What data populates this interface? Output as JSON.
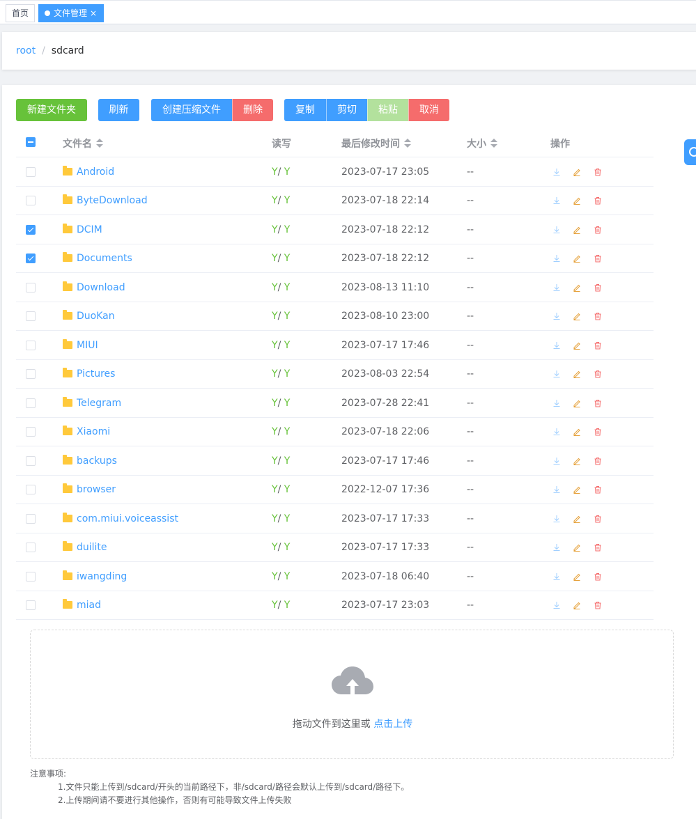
{
  "tabs": {
    "home": "首页",
    "active": "文件管理",
    "close": "×"
  },
  "breadcrumb": {
    "root": "root",
    "separator": "/",
    "current": "sdcard"
  },
  "toolbar": {
    "new_folder": "新建文件夹",
    "refresh": "刷新",
    "create_zip": "创建压缩文件",
    "delete": "删除",
    "copy": "复制",
    "cut": "剪切",
    "paste": "粘贴",
    "cancel": "取消"
  },
  "table": {
    "headers": {
      "name": "文件名",
      "rw": "读写",
      "modified": "最后修改时间",
      "size": "大小",
      "actions": "操作"
    },
    "rows": [
      {
        "name": "Android",
        "r": "Y",
        "w": "Y",
        "time": "2023-07-17 23:05",
        "size": "--",
        "checked": false
      },
      {
        "name": "ByteDownload",
        "r": "Y",
        "w": "Y",
        "time": "2023-07-18 22:14",
        "size": "--",
        "checked": false
      },
      {
        "name": "DCIM",
        "r": "Y",
        "w": "Y",
        "time": "2023-07-18 22:12",
        "size": "--",
        "checked": true
      },
      {
        "name": "Documents",
        "r": "Y",
        "w": "Y",
        "time": "2023-07-18 22:12",
        "size": "--",
        "checked": true
      },
      {
        "name": "Download",
        "r": "Y",
        "w": "Y",
        "time": "2023-08-13 11:10",
        "size": "--",
        "checked": false
      },
      {
        "name": "DuoKan",
        "r": "Y",
        "w": "Y",
        "time": "2023-08-10 23:00",
        "size": "--",
        "checked": false
      },
      {
        "name": "MIUI",
        "r": "Y",
        "w": "Y",
        "time": "2023-07-17 17:46",
        "size": "--",
        "checked": false
      },
      {
        "name": "Pictures",
        "r": "Y",
        "w": "Y",
        "time": "2023-08-03 22:54",
        "size": "--",
        "checked": false
      },
      {
        "name": "Telegram",
        "r": "Y",
        "w": "Y",
        "time": "2023-07-28 22:41",
        "size": "--",
        "checked": false
      },
      {
        "name": "Xiaomi",
        "r": "Y",
        "w": "Y",
        "time": "2023-07-18 22:06",
        "size": "--",
        "checked": false
      },
      {
        "name": "backups",
        "r": "Y",
        "w": "Y",
        "time": "2023-07-17 17:46",
        "size": "--",
        "checked": false
      },
      {
        "name": "browser",
        "r": "Y",
        "w": "Y",
        "time": "2022-12-07 17:36",
        "size": "--",
        "checked": false
      },
      {
        "name": "com.miui.voiceassist",
        "r": "Y",
        "w": "Y",
        "time": "2023-07-17 17:33",
        "size": "--",
        "checked": false
      },
      {
        "name": "duilite",
        "r": "Y",
        "w": "Y",
        "time": "2023-07-17 17:33",
        "size": "--",
        "checked": false
      },
      {
        "name": "iwangding",
        "r": "Y",
        "w": "Y",
        "time": "2023-07-18 06:40",
        "size": "--",
        "checked": false
      },
      {
        "name": "miad",
        "r": "Y",
        "w": "Y",
        "time": "2023-07-17 23:03",
        "size": "--",
        "checked": false
      }
    ]
  },
  "upload": {
    "drag_text": "拖动文件到这里或 ",
    "click_text": "点击上传"
  },
  "notes": {
    "title": "注意事项:",
    "items": [
      "1.文件只能上传到/sdcard/开头的当前路径下，非/sdcard/路径会默认上传到/sdcard/路径下。",
      "2.上传期间请不要进行其他操作，否则有可能导致文件上传失败"
    ]
  },
  "colors": {
    "primary": "#409eff",
    "success": "#67c23a",
    "danger": "#f56c6c",
    "warning": "#e6a23c",
    "folder": "#ffc93b"
  },
  "icons": {
    "download": "download-icon",
    "edit": "edit-icon",
    "delete": "trash-icon",
    "folder": "folder-icon",
    "upload": "cloud-upload-icon"
  }
}
